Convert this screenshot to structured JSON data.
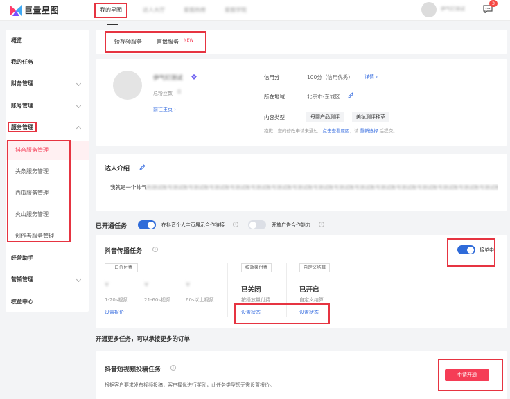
{
  "topbar": {
    "logo_text": "巨量星图",
    "nav": [
      "我的星图",
      "达人大厅",
      "星图热榜",
      "星图学院"
    ],
    "username": "伊气钉测试",
    "badge_count": "3"
  },
  "sidebar": {
    "items": [
      "概览",
      "我的任务",
      "财务管理",
      "账号管理",
      "服务管理"
    ],
    "service_subitems": [
      "抖音服务管理",
      "头条服务管理",
      "西瓜服务管理",
      "火山服务管理",
      "创作者服务管理"
    ],
    "bottom_items": [
      "经营助手",
      "营销管理",
      "权益中心"
    ]
  },
  "tabs": {
    "short_video": "短视频服务",
    "live": "直播服务",
    "new_badge": "NEW"
  },
  "profile": {
    "name": "伊气钉测试",
    "fans_label": "总粉丝数",
    "fans_value": "0",
    "homepage_link": "前往主页",
    "credit_label": "信用分",
    "credit_value": "100分（信用优秀）",
    "credit_detail": "详情",
    "location_label": "所在地域",
    "location_value": "北京市-东城区",
    "content_type_label": "内容类型",
    "content_tags": [
      "母婴产品测评",
      "美妆测评种草"
    ],
    "notice_prefix": "抱歉，您的修改申请未通过，",
    "notice_link1": "点击查看原因",
    "notice_mid": "，请 ",
    "notice_link2": "重新选择",
    "notice_suffix": " 后提交。"
  },
  "intro": {
    "title": "达人介绍",
    "text_prefix": "我就是一个帅气",
    "text_blurred": "的测试账号测试账号测试账号测试账号测试账号测试账号测试账号测试账号测试账号测试账号测试账号测试账号测试账号测试账号测试账号测试账号测试账号测试"
  },
  "opened_tasks": {
    "title": "已开通任务",
    "toggle1_label": "在抖音个人主页展示合作链接",
    "toggle2_label": "开放广告合作能力"
  },
  "douyin_task": {
    "title": "抖音传播任务",
    "status_label": "接单中",
    "fixed_price_label": "一口价付费",
    "prices": [
      {
        "value": "¥",
        "label": "1-20s视频"
      },
      {
        "value": "¥",
        "label": "21-60s视频"
      },
      {
        "value": "¥",
        "label": "60s以上视频"
      }
    ],
    "set_price_link": "设置报价",
    "effect_col": {
      "header": "按效果付费",
      "status": "已关闭",
      "desc": "按播放量付费",
      "link": "设置状态"
    },
    "custom_col": {
      "header": "自定义结算",
      "status": "已开启",
      "desc": "自定义结算",
      "link": "设置状态"
    }
  },
  "more_tasks": {
    "heading": "开通更多任务，可以承接更多的订单",
    "card_title": "抖音短视频投稿任务",
    "card_desc": "根据客户要求发布视频投稿，客户择优进行奖励，此任务类型您无需设置报价。",
    "apply_button": "申请开通"
  },
  "colors": {
    "accent": "#2f6bd9",
    "highlight": "#e63441",
    "apply": "#f53d56"
  }
}
